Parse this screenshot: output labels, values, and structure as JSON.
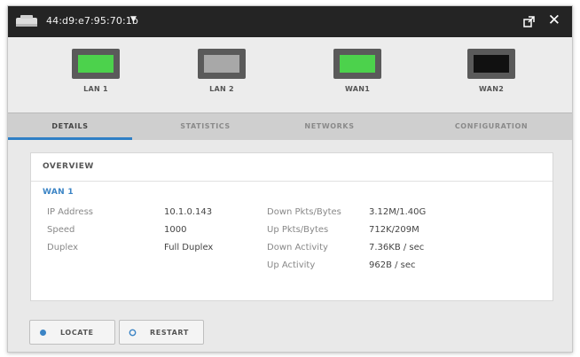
{
  "titlebar": {
    "device_id": "44:d9:e7:95:70:1b",
    "caret": "▼",
    "close_glyph": "✕"
  },
  "ports": [
    {
      "label": "LAN 1",
      "state_color": "#4cd24c"
    },
    {
      "label": "LAN 2",
      "state_color": "#a8a8a8"
    },
    {
      "label": "WAN1",
      "state_color": "#4cd24c"
    },
    {
      "label": "WAN2",
      "state_color": "#111111"
    }
  ],
  "tabs": [
    "DETAILS",
    "STATISTICS",
    "NETWORKS",
    "CONFIGURATION"
  ],
  "active_tab": "DETAILS",
  "overview": {
    "heading": "OVERVIEW",
    "section_title": "WAN 1",
    "left": [
      {
        "label": "IP Address",
        "value": "10.1.0.143"
      },
      {
        "label": "Speed",
        "value": "1000"
      },
      {
        "label": "Duplex",
        "value": "Full Duplex"
      }
    ],
    "right": [
      {
        "label": "Down Pkts/Bytes",
        "value": "3.12M/1.40G"
      },
      {
        "label": "Up Pkts/Bytes",
        "value": "712K/209M"
      },
      {
        "label": "Down Activity",
        "value": "7.36KB / sec"
      },
      {
        "label": "Up Activity",
        "value": "962B / sec"
      }
    ]
  },
  "buttons": {
    "locate": "LOCATE",
    "restart": "RESTART"
  },
  "colors": {
    "accent": "#2f7fc5",
    "link_heading": "#3b84c5",
    "titlebar_bg": "#242424"
  }
}
